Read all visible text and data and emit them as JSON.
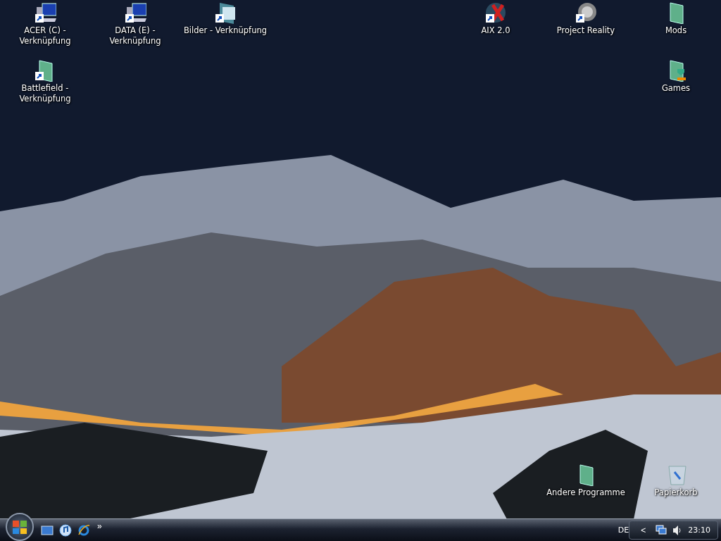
{
  "desktop": {
    "icons": [
      {
        "label": "ACER (C) -\nVerknüpfung",
        "kind": "drive",
        "shortcut": true
      },
      {
        "label": "DATA (E) -\nVerknüpfung",
        "kind": "drive",
        "shortcut": true
      },
      {
        "label": "Bilder - Verknüpfung",
        "kind": "pictures",
        "shortcut": true
      },
      {
        "label": "AIX 2.0",
        "kind": "app-x",
        "shortcut": true
      },
      {
        "label": "Project Reality",
        "kind": "app-pr",
        "shortcut": true
      },
      {
        "label": "Mods",
        "kind": "folder",
        "shortcut": false
      },
      {
        "label": "Battlefield -\nVerknüpfung",
        "kind": "folder",
        "shortcut": true
      },
      {
        "label": "Games",
        "kind": "games",
        "shortcut": false
      },
      {
        "label": "Andere Programme",
        "kind": "folder",
        "shortcut": false
      },
      {
        "label": "Papierkorb",
        "kind": "bin",
        "shortcut": false
      }
    ]
  },
  "taskbar": {
    "quick_launch": [
      {
        "kind": "desktop"
      },
      {
        "kind": "media"
      },
      {
        "kind": "browser"
      }
    ],
    "more": "»",
    "language": "DE",
    "tray_toggle": "<",
    "clock": "23:10"
  }
}
